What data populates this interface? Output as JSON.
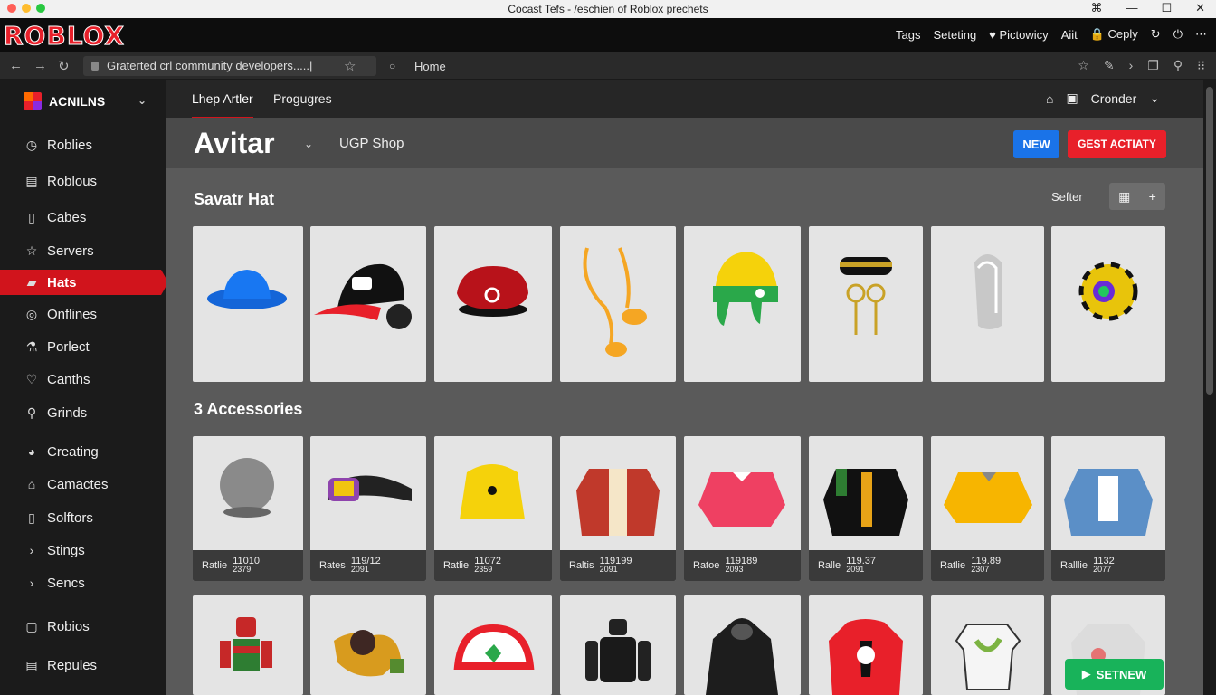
{
  "window": {
    "title": "Cocast Tefs - /eschien of Roblox prechets",
    "controls": [
      "⌘",
      "—",
      "☐",
      "✕"
    ]
  },
  "appbar": {
    "logo": "ROBLOX",
    "links": [
      "Tags",
      "Seteting",
      "♥ Pictowicy",
      "Aiit",
      "🔒 Ceply",
      "↻",
      "⏻",
      "⋯"
    ]
  },
  "addressbar": {
    "url": "Graterted crl community developers.....|",
    "home_tab": "Home"
  },
  "sidebar": {
    "account": "ACNILNS",
    "items": [
      {
        "label": "Roblies",
        "icon": "◷"
      },
      {
        "label": "Roblous",
        "icon": "▤"
      },
      {
        "label": "Cabes",
        "icon": "▯"
      },
      {
        "label": "Servers",
        "icon": "☆"
      },
      {
        "label": "Hats",
        "icon": "▰"
      },
      {
        "label": "Onflines",
        "icon": "◎"
      },
      {
        "label": "Porlect",
        "icon": "⚗"
      },
      {
        "label": "Canths",
        "icon": "♡"
      },
      {
        "label": "Grinds",
        "icon": "⚲"
      },
      {
        "label": "Creating",
        "icon": "◕"
      },
      {
        "label": "Camactes",
        "icon": "⌂"
      },
      {
        "label": "Solftors",
        "icon": "▯"
      },
      {
        "label": "Stings",
        "icon": "›"
      },
      {
        "label": "Sencs",
        "icon": "›"
      },
      {
        "label": "Robios",
        "icon": "▢"
      },
      {
        "label": "Repules",
        "icon": "▤"
      }
    ]
  },
  "subnav": {
    "tabs": [
      "Lhep Artler",
      "Progugres"
    ],
    "user": "Cronder"
  },
  "pagehead": {
    "title": "Avitar",
    "shop": "UGP Shop",
    "new_btn": "NEW",
    "get_btn": "GEST ACTIATY"
  },
  "sections": {
    "hats_title": "Savatr Hat",
    "sorter": "Sefter",
    "accessories_title": "3 Accessories"
  },
  "accessories": [
    {
      "name": "Ratlie",
      "price": "11010",
      "year": "2379"
    },
    {
      "name": "Rates",
      "price": "119/12",
      "year": "2091"
    },
    {
      "name": "Ratlie",
      "price": "11072",
      "year": "2359"
    },
    {
      "name": "Raltis",
      "price": "119199",
      "year": "2091"
    },
    {
      "name": "Ratoe",
      "price": "119189",
      "year": "2093"
    },
    {
      "name": "Ralle",
      "price": "119.37",
      "year": "2091"
    },
    {
      "name": "Ratlie",
      "price": "119.89",
      "year": "2307"
    },
    {
      "name": "Ralllie",
      "price": "1132",
      "year": "2077"
    }
  ],
  "floating": {
    "setnew": "SETNEW"
  },
  "colors": {
    "brand_red": "#d1141c",
    "blue": "#1a73e8",
    "green": "#18b35a"
  }
}
